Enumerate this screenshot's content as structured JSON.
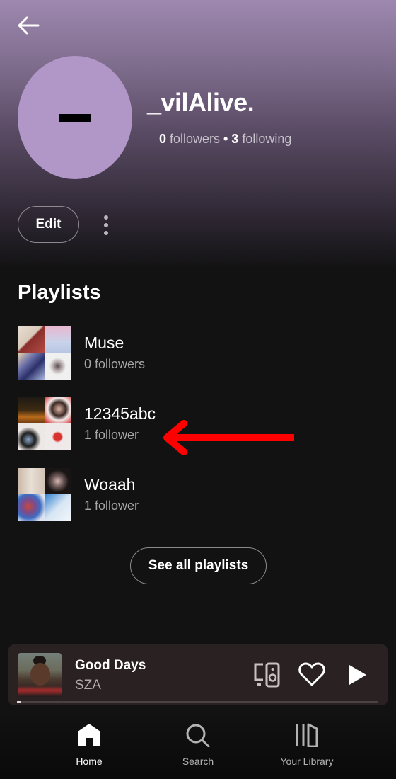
{
  "profile": {
    "username": "_vilAlive.",
    "avatar_initial": "–",
    "avatar_color": "#b197c8",
    "followers_count": "0",
    "followers_label": "followers",
    "following_count": "3",
    "following_label": "following",
    "separator": "•",
    "edit_label": "Edit"
  },
  "playlists_section": {
    "title": "Playlists",
    "items": [
      {
        "name": "Muse",
        "followers": "0 followers",
        "cover_colors": [
          "#b98a7a",
          "#e7b8d0",
          "#6c70a8",
          "#eeeeee"
        ]
      },
      {
        "name": "12345abc",
        "followers": "1 follower",
        "cover_colors": [
          "#6b3a12",
          "#f3eaea",
          "#ece8e6",
          "#efe9e9"
        ]
      },
      {
        "name": "Woaah",
        "followers": "1 follower",
        "cover_colors": [
          "#c9b7a8",
          "#2e2425",
          "#3d6cc2",
          "#d7e6f4"
        ]
      }
    ],
    "see_all_label": "See all playlists"
  },
  "annotation": {
    "type": "arrow",
    "color": "#ff0000",
    "points_to": "12345abc 1 follower"
  },
  "now_playing": {
    "title": "Good Days",
    "artist": "SZA",
    "progress_fraction": 0.01
  },
  "bottom_nav": {
    "items": [
      {
        "label": "Home",
        "icon": "home-icon",
        "active": true
      },
      {
        "label": "Search",
        "icon": "search-icon",
        "active": false
      },
      {
        "label": "Your Library",
        "icon": "library-icon",
        "active": false
      }
    ]
  },
  "colors": {
    "background": "#121212",
    "header_top": "#9e88b0",
    "mini_player_bg": "#2a2123",
    "secondary_text": "#a7a7a7"
  }
}
